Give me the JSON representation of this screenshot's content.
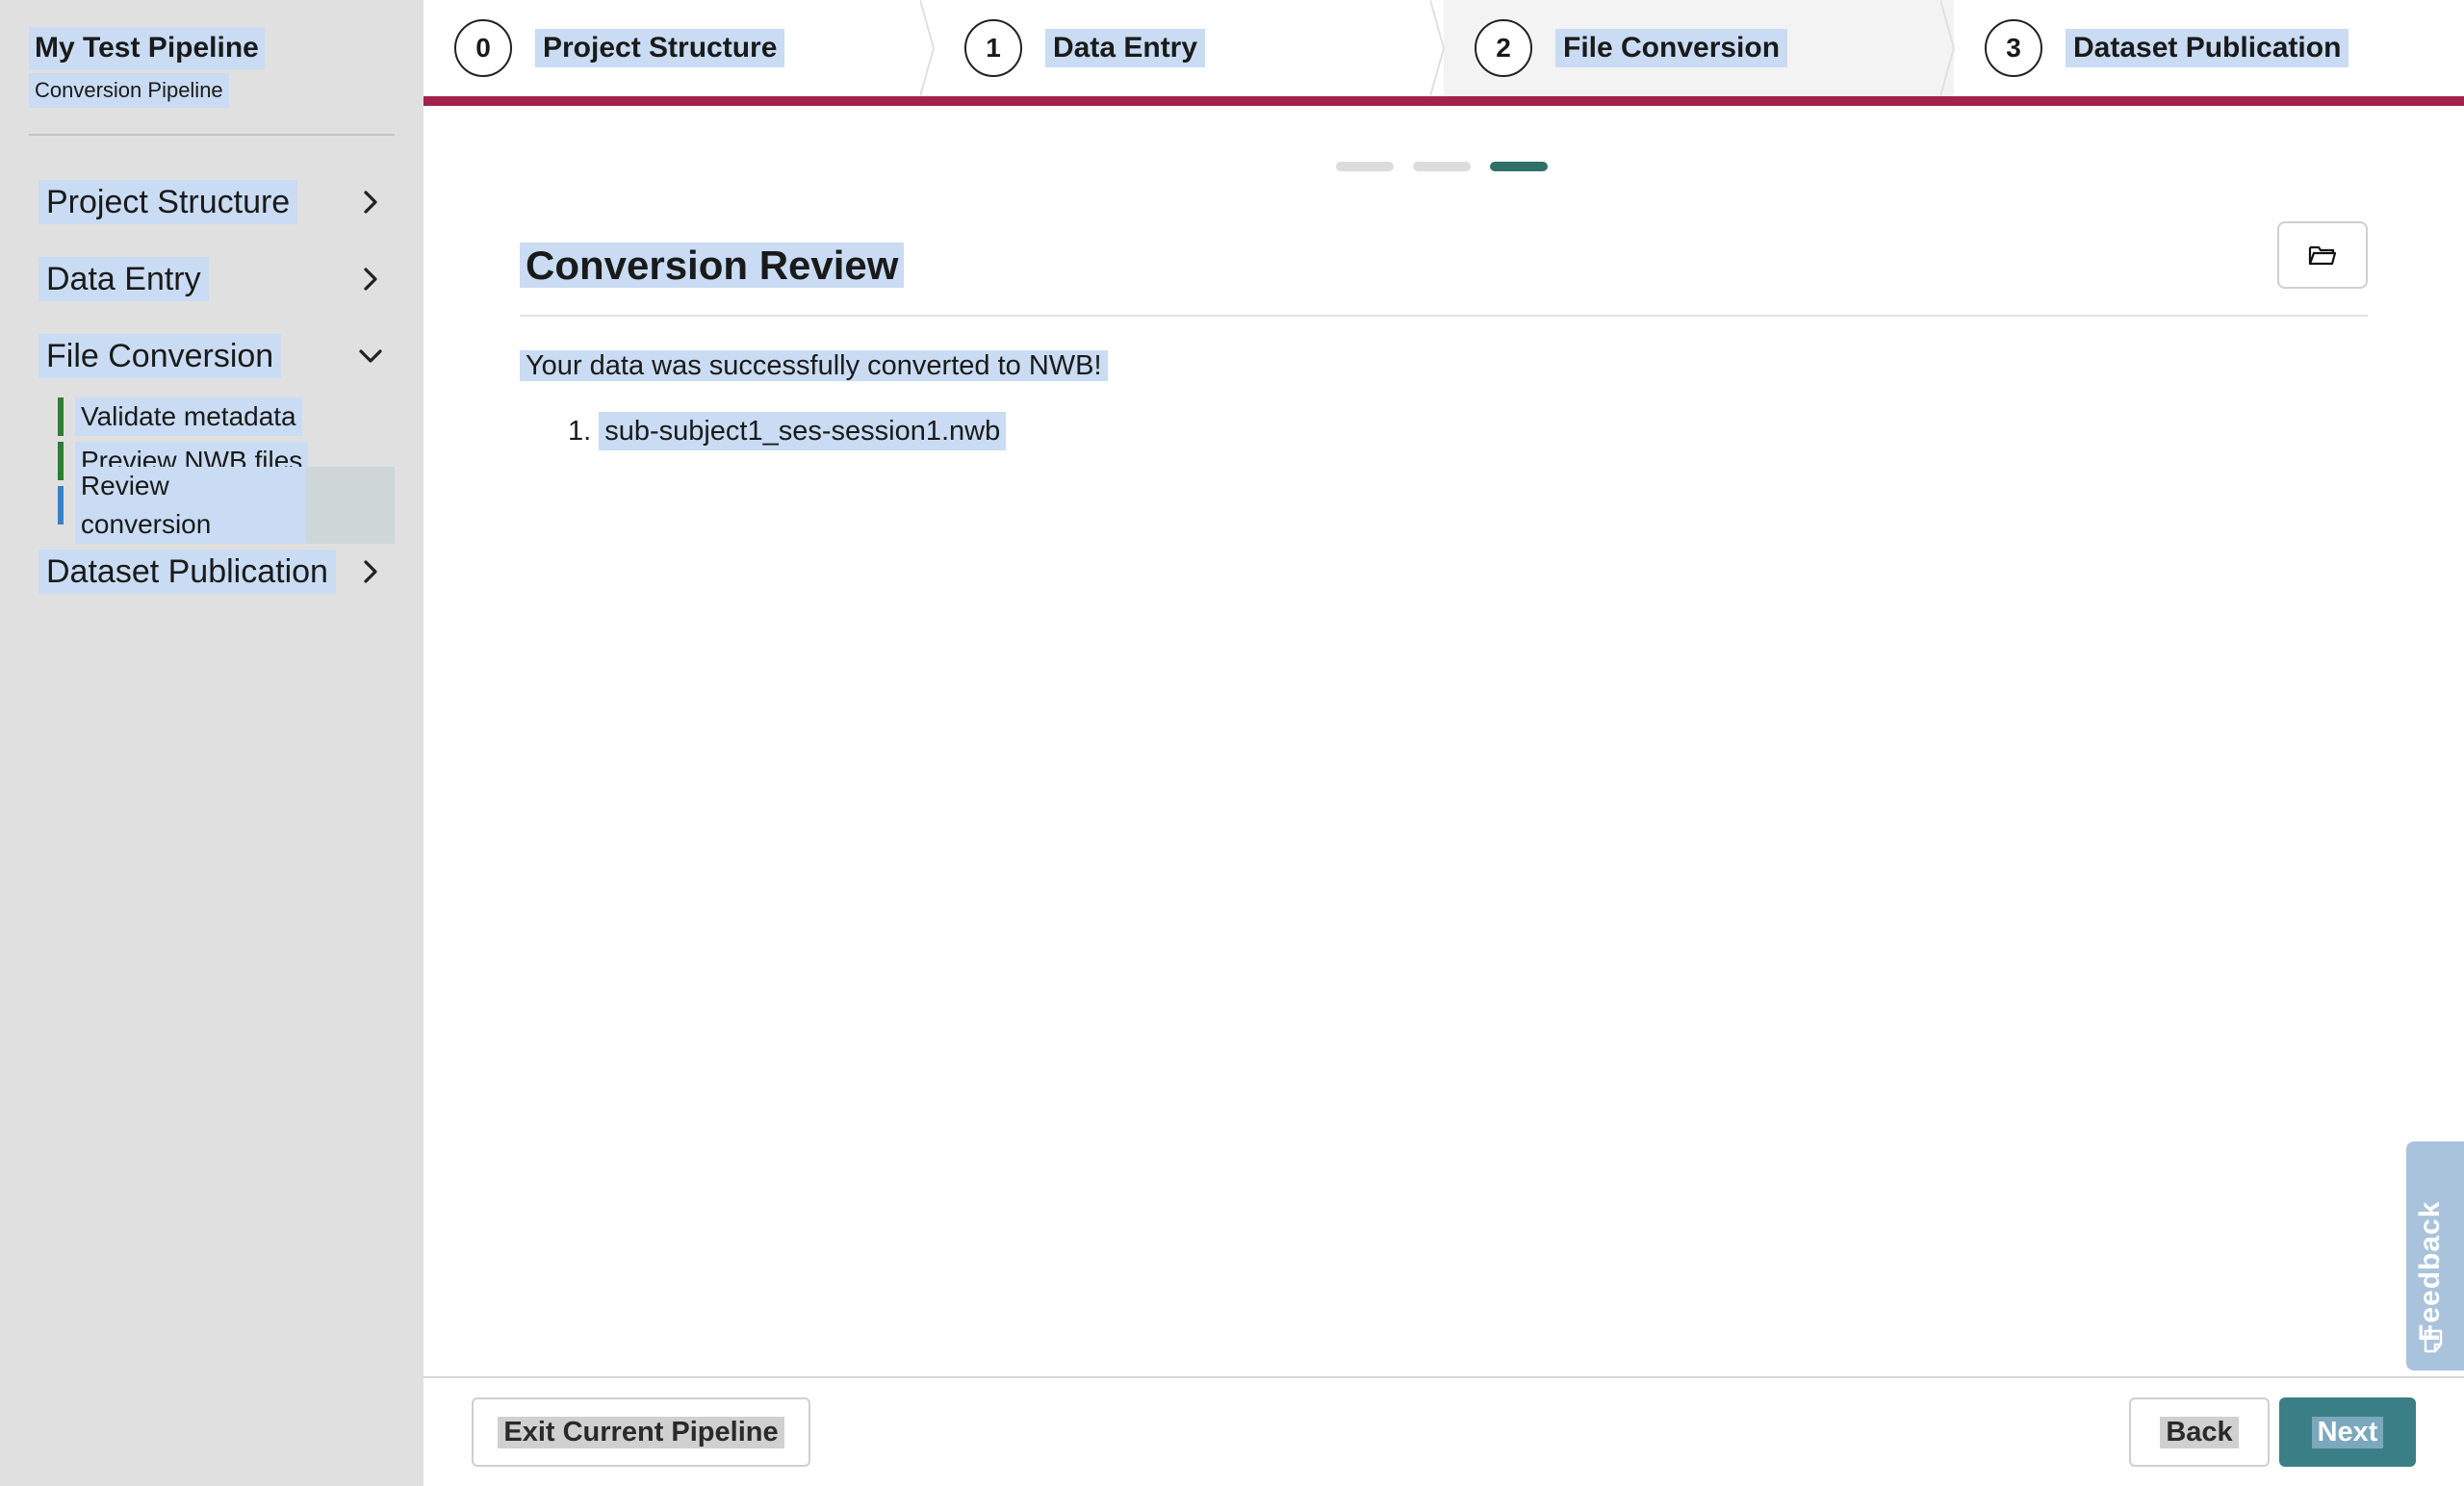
{
  "sidebar": {
    "title": "My Test Pipeline",
    "subtitle": "Conversion Pipeline",
    "sections": [
      {
        "label": "Project Structure",
        "state": "collapsed"
      },
      {
        "label": "Data Entry",
        "state": "collapsed"
      },
      {
        "label": "File Conversion",
        "state": "expanded",
        "items": [
          {
            "label": "Validate metadata",
            "status": "complete"
          },
          {
            "label": "Preview NWB files",
            "status": "complete"
          },
          {
            "label": "Review conversion",
            "status": "active"
          }
        ]
      },
      {
        "label": "Dataset Publication",
        "state": "collapsed"
      }
    ]
  },
  "stepper": {
    "steps": [
      {
        "number": "0",
        "label": "Project Structure"
      },
      {
        "number": "1",
        "label": "Data Entry"
      },
      {
        "number": "2",
        "label": "File Conversion",
        "current": true
      },
      {
        "number": "3",
        "label": "Dataset Publication"
      }
    ],
    "progress_color": "#a3224a"
  },
  "page": {
    "substep_index": 3,
    "substep_total": 3,
    "title": "Conversion Review",
    "folder_button_icon": "folder-open-icon",
    "message": "Your data was successfully converted to NWB!",
    "files": [
      {
        "index": "1.",
        "name": "sub-subject1_ses-session1.nwb"
      }
    ]
  },
  "feedback": {
    "label": "Feedback",
    "icon": "feedback-icon"
  },
  "footer": {
    "exit_label": "Exit Current Pipeline",
    "back_label": "Back",
    "next_label": "Next",
    "next_color": "#3b7f86"
  }
}
